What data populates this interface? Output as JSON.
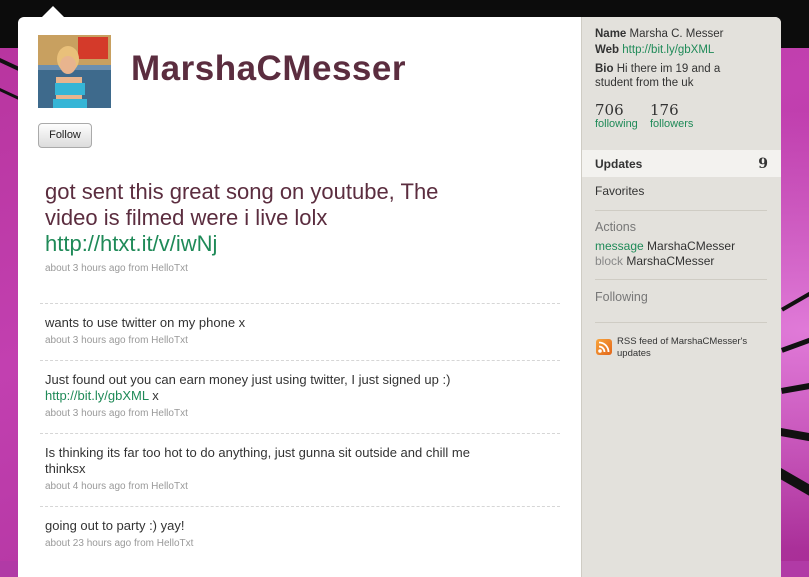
{
  "profile": {
    "screen_name": "MarshaCMesser",
    "follow_label": "Follow",
    "avatar_icon": "profile-photo"
  },
  "latest": {
    "text": "got sent this great song on youtube, The video is filmed were i live lolx",
    "link": "http://htxt.it/v/iwNj",
    "meta": "about 3 hours ago from HelloTxt"
  },
  "timeline": [
    {
      "text": "wants to use twitter on my phone x",
      "meta": "about 3 hours ago from HelloTxt"
    },
    {
      "text": "Just found out you can earn money just using twitter, I just signed up :)",
      "link": "http://bit.ly/gbXML",
      "suffix": "x",
      "meta": "about 3 hours ago from HelloTxt"
    },
    {
      "text": "Is thinking its far too hot to do anything, just gunna sit outside and chill me thinksx",
      "meta": "about 4 hours ago from HelloTxt"
    },
    {
      "text": "going out to party :) yay!",
      "meta": "about 23 hours ago from HelloTxt"
    }
  ],
  "sidebar": {
    "name_label": "Name",
    "name_value": "Marsha C. Messer",
    "web_label": "Web",
    "web_value": "http://bit.ly/gbXML",
    "bio_label": "Bio",
    "bio_value": "Hi there im 19 and a student from the uk",
    "following_count": "706",
    "following_label": "following",
    "followers_count": "176",
    "followers_label": "followers",
    "updates_label": "Updates",
    "updates_count": "9",
    "favorites_label": "Favorites",
    "actions_label": "Actions",
    "message_label": "message",
    "message_target": "MarshaCMesser",
    "block_label": "block",
    "block_target": "MarshaCMesser",
    "following_section_label": "Following",
    "rss_label": "RSS feed of MarshaCMesser's updates",
    "rss_icon": "rss-icon"
  },
  "colors": {
    "accent_link": "#1f8a58",
    "name_color": "#5b2d3f",
    "background": "#b13aa6"
  }
}
